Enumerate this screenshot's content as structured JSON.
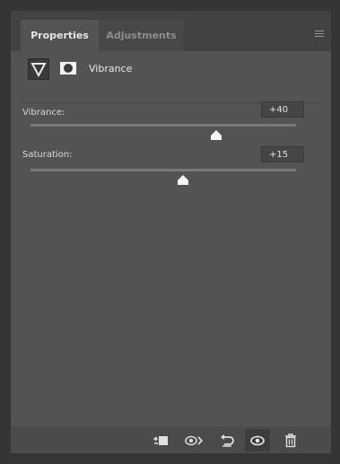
{
  "tabs": {
    "active": "Properties",
    "inactive": "Adjustments"
  },
  "header": {
    "title": "Vibrance",
    "adjustment_icon": "vibrance-triangle-icon",
    "mask_icon": "layer-mask-icon"
  },
  "sliders": [
    {
      "label": "Vibrance:",
      "value": "+40",
      "fraction": 0.7
    },
    {
      "label": "Saturation:",
      "value": "+15",
      "fraction": 0.575
    }
  ],
  "bottom_bar": {
    "icons": [
      "clip-to-layer-icon",
      "view-previous-state-icon",
      "reset-icon",
      "toggle-visibility-icon",
      "delete-icon"
    ]
  }
}
